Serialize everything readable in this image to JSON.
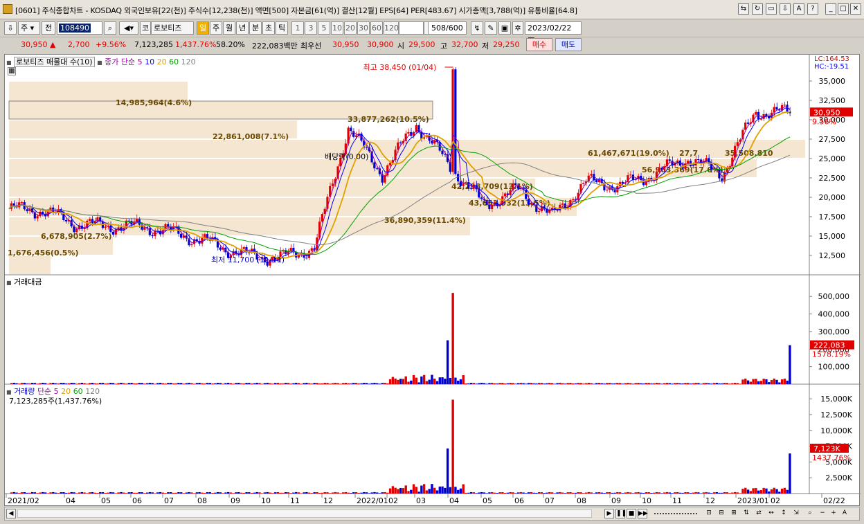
{
  "window": {
    "title": "[0601] 주식종합차트 - KOSDAQ 외국인보유[22(천)] 주식수[12,238(천)] 액면[500] 자본금[61(억)] 결산[12월] EPS[64] PER[483.67] 시가총액[3,788(억)] 유통비율[64.8]"
  },
  "toolbar": {
    "type_select": "주",
    "prev_label": "전",
    "code": "108490",
    "market_label": "코",
    "stock_name": "로보티즈",
    "periods": [
      "일",
      "주",
      "월",
      "년",
      "분",
      "초",
      "틱"
    ],
    "active_period": "일",
    "intervals": [
      "1",
      "3",
      "5",
      "10",
      "20",
      "30",
      "60",
      "120"
    ],
    "count": "508",
    "count_max": "/600",
    "date": "2023/02/22"
  },
  "quote": {
    "price": "30,950",
    "change": "2,700",
    "change_pct": "+9.56%",
    "volume": "7,123,285",
    "volume_pct": "1,437.76%",
    "ratio": "58.20%",
    "amount": "222,083백만",
    "best_label": "최우선",
    "ask": "30,950",
    "bid": "30,900",
    "open_label": "시",
    "open": "29,500",
    "high_label": "고",
    "high": "32,700",
    "low_label": "저",
    "low": "29,250",
    "buy_label": "매수",
    "sell_label": "매도"
  },
  "price_panel": {
    "legend_name": "로보티즈 매물대 수(10)",
    "ma_label": "종가 단순 5",
    "ma_periods": [
      "10",
      "20",
      "60",
      "120"
    ],
    "lc": "LC:164.53",
    "hc": "HC:-19.51",
    "current": "30,950",
    "current_pct": "9.56%",
    "high_note": "최고 38,450 (01/04)",
    "low_note": "최저 11,700 (11/11)",
    "div_note_1": "배당락(0.00)",
    "div_note_2": "배당락(0.00)",
    "y_ticks": [
      "35,000",
      "32,500",
      "30,000",
      "27,500",
      "25,000",
      "22,500",
      "20,000",
      "17,500",
      "15,000",
      "12,500"
    ],
    "profile_labels": [
      "14,985,964(4.6%)",
      "33,877,262(10.5%)",
      "22,861,008(7.1%)",
      "61,467,671(19.0%)",
      "27,7",
      "35,508,810",
      "42,298,709(13.1%)",
      "43,653,932(13.5%)",
      "56,963,369(17.6%)",
      "36,890,359(11.4%)",
      "6,678,905(2.7%)",
      "1,676,456(0.5%)"
    ]
  },
  "amount_panel": {
    "legend": "거래대금",
    "y_ticks": [
      "500,000",
      "400,000",
      "300,000",
      "200,000",
      "100,000"
    ],
    "current": "222,083",
    "current_pct": "1578.19%"
  },
  "volume_panel": {
    "legend_name": "거래량",
    "legend_ma": "단순 5",
    "ma_periods": [
      "20",
      "60",
      "120"
    ],
    "sub_legend": "7,123,285주(1,437.76%)",
    "y_ticks": [
      "15,000K",
      "12,500K",
      "10,000K",
      "7,500K",
      "5,000K",
      "2,500K"
    ],
    "current": "7,123K",
    "current_pct": "1437.76%"
  },
  "x_axis": [
    "2021/02",
    "04",
    "05",
    "06",
    "07",
    "08",
    "09",
    "10",
    "11",
    "12",
    "2022/01",
    "02",
    "03",
    "04",
    "05",
    "06",
    "07",
    "08",
    "09",
    "10",
    "11",
    "12",
    "2023/01",
    "02",
    "02/22"
  ],
  "colors": {
    "up": "#e00000",
    "down": "#0000d0",
    "ma5": "#a000a0",
    "ma10": "#0000ff",
    "ma20": "#e0a000",
    "ma60": "#00a000",
    "ma120": "#808080",
    "profile": "#f5e6d2"
  },
  "chart_data": {
    "type": "candlestick",
    "title": "로보티즈",
    "y_range": [
      10000,
      37500
    ],
    "high": 38450,
    "low": 11700,
    "last_close": 30950,
    "monthly_close": [
      {
        "x": "2021/02",
        "close": 18500
      },
      {
        "x": "04",
        "close": 18300
      },
      {
        "x": "05",
        "close": 16500
      },
      {
        "x": "06",
        "close": 16300
      },
      {
        "x": "07",
        "close": 16200
      },
      {
        "x": "08",
        "close": 15300
      },
      {
        "x": "09",
        "close": 14000
      },
      {
        "x": "10",
        "close": 12500
      },
      {
        "x": "11",
        "close": 12200
      },
      {
        "x": "12",
        "close": 13500
      },
      {
        "x": "2022/01",
        "close": 29000
      },
      {
        "x": "02",
        "close": 23000
      },
      {
        "x": "03",
        "close": 29500
      },
      {
        "x": "04",
        "close": 24000
      },
      {
        "x": "05",
        "close": 19000
      },
      {
        "x": "06",
        "close": 21000
      },
      {
        "x": "07",
        "close": 17500
      },
      {
        "x": "08",
        "close": 22000
      },
      {
        "x": "09",
        "close": 21500
      },
      {
        "x": "10",
        "close": 23000
      },
      {
        "x": "11",
        "close": 25000
      },
      {
        "x": "12",
        "close": 23000
      },
      {
        "x": "2023/01",
        "close": 31000
      },
      {
        "x": "02",
        "close": 30950
      }
    ]
  }
}
